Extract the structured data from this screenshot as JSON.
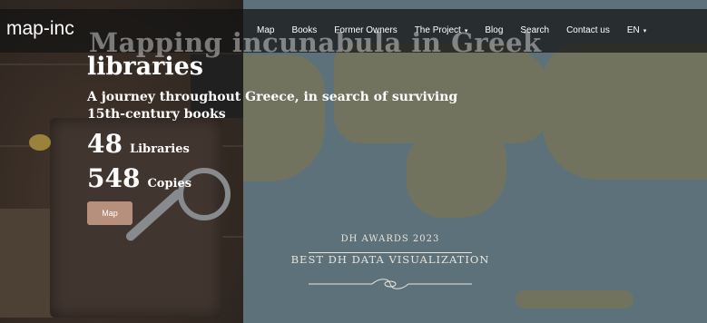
{
  "nav": {
    "logo": "map-inc",
    "items": [
      {
        "label": "Map"
      },
      {
        "label": "Books"
      },
      {
        "label": "Former Owners"
      },
      {
        "label": "The Project",
        "caret": "▾"
      },
      {
        "label": "Blog"
      },
      {
        "label": "Search"
      },
      {
        "label": "Contact us"
      },
      {
        "label": "EN",
        "caret": "▾"
      }
    ]
  },
  "hero": {
    "title_line1": "Mapping incunabula in Greek",
    "title_line2": "libraries",
    "subtitle": "A journey throughout Greece, in search of surviving 15th-century books",
    "stats": [
      {
        "number": "48",
        "label": "Libraries"
      },
      {
        "number": "548",
        "label": "Copies"
      }
    ],
    "map_button": "Map"
  },
  "award": {
    "line1": "DH AWARDS 2023",
    "line2": "BEST DH DATA VISUALIZATION"
  },
  "colors": {
    "nav_bg": "#141414",
    "button_bg": "#b7907d",
    "map_sea": "#6f8a97",
    "map_land": "#8a8d72"
  }
}
